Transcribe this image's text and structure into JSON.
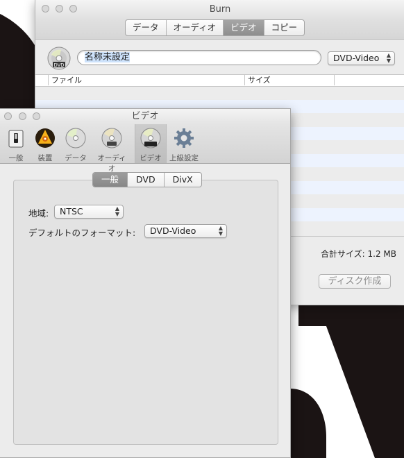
{
  "main_window": {
    "title": "Burn",
    "tabs": [
      {
        "label": "データ",
        "active": false
      },
      {
        "label": "オーディオ",
        "active": false
      },
      {
        "label": "ビデオ",
        "active": true
      },
      {
        "label": "コピー",
        "active": false
      }
    ],
    "disc_icon_label": "DVD",
    "disc_name": "名称未設定",
    "format_select": "DVD-Video",
    "columns": [
      "ファイル",
      "サイズ"
    ],
    "total_size": "合計サイズ: 1.2 MB",
    "create_button": "ディスク作成"
  },
  "prefs_window": {
    "title": "ビデオ",
    "toolbar": [
      {
        "label": "一般",
        "icon": "switch-icon"
      },
      {
        "label": "装置",
        "icon": "burn-device-icon"
      },
      {
        "label": "データ",
        "icon": "data-disc-icon"
      },
      {
        "label": "オーディオ",
        "icon": "audio-disc-icon"
      },
      {
        "label": "ビデオ",
        "icon": "dvd-disc-icon",
        "selected": true
      },
      {
        "label": "上級設定",
        "icon": "gear-icon"
      }
    ],
    "tabs": [
      {
        "label": "一般",
        "active": true
      },
      {
        "label": "DVD",
        "active": false
      },
      {
        "label": "DivX",
        "active": false
      }
    ],
    "region_label": "地域:",
    "region_value": "NTSC",
    "default_format_label": "デフォルトのフォーマット:",
    "default_format_value": "DVD-Video"
  },
  "colors": {
    "accent_selected_tab": "#8e8e8e",
    "alternating_row": "#edf3fe"
  }
}
